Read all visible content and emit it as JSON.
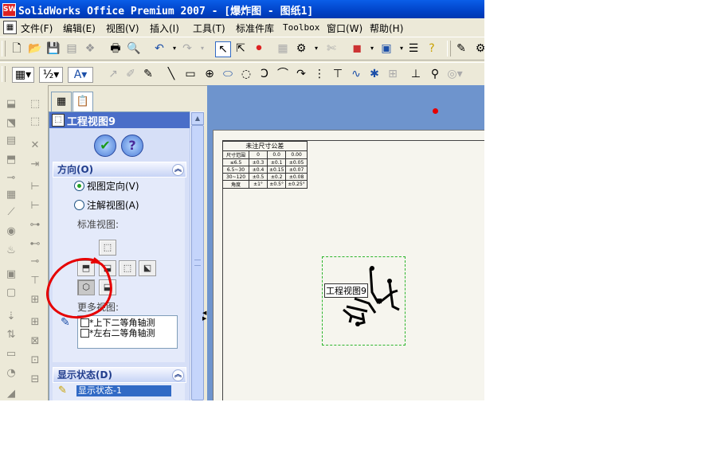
{
  "window": {
    "title": "SolidWorks Office Premium 2007 - [爆炸图 - 图纸1]",
    "logo_text": "SW"
  },
  "menu": {
    "items": [
      "文件(F)",
      "编辑(E)",
      "视图(V)",
      "插入(I)",
      "工具(T)",
      "标准件库",
      "Toolbox",
      "窗口(W)",
      "帮助(H)"
    ]
  },
  "property_manager": {
    "title": "工程视图9",
    "ok_glyph": "✔",
    "help_glyph": "?",
    "orientation": {
      "title": "方向(O)",
      "collapse_glyph": "︽",
      "option_view_orientation": "视图定向(V)",
      "option_annotation_view": "注解视图(A)",
      "standard_views_label": "标准视图:",
      "more_views_label": "更多视图:",
      "more_views": [
        "*上下二等角轴测",
        "*左右二等角轴测"
      ]
    },
    "display_state": {
      "title": "显示状态(D)",
      "collapse_glyph": "︽",
      "selected": "显示状态-1"
    }
  },
  "drawing": {
    "tolerance_table": {
      "title": "未注尺寸公差",
      "rows": [
        [
          "尺寸范围",
          "0",
          "0.0",
          "0.00"
        ],
        [
          "≤6.5",
          "±0.3",
          "±0.1",
          "±0.05"
        ],
        [
          "6.5~30",
          "±0.4",
          "±0.15",
          "±0.07"
        ],
        [
          "30~120",
          "±0.5",
          "±0.2",
          "±0.08"
        ],
        [
          "角度",
          "±1°",
          "±0.5°",
          "±0.25°"
        ]
      ]
    },
    "view_label": "工程视图9"
  },
  "colors": {
    "graphics_bg": "#6e94cd",
    "sheet_bg": "#f6f5ee",
    "pm_bg": "#d6dff7",
    "annotation_red": "#e60000",
    "view_border": "#2bb52b"
  }
}
